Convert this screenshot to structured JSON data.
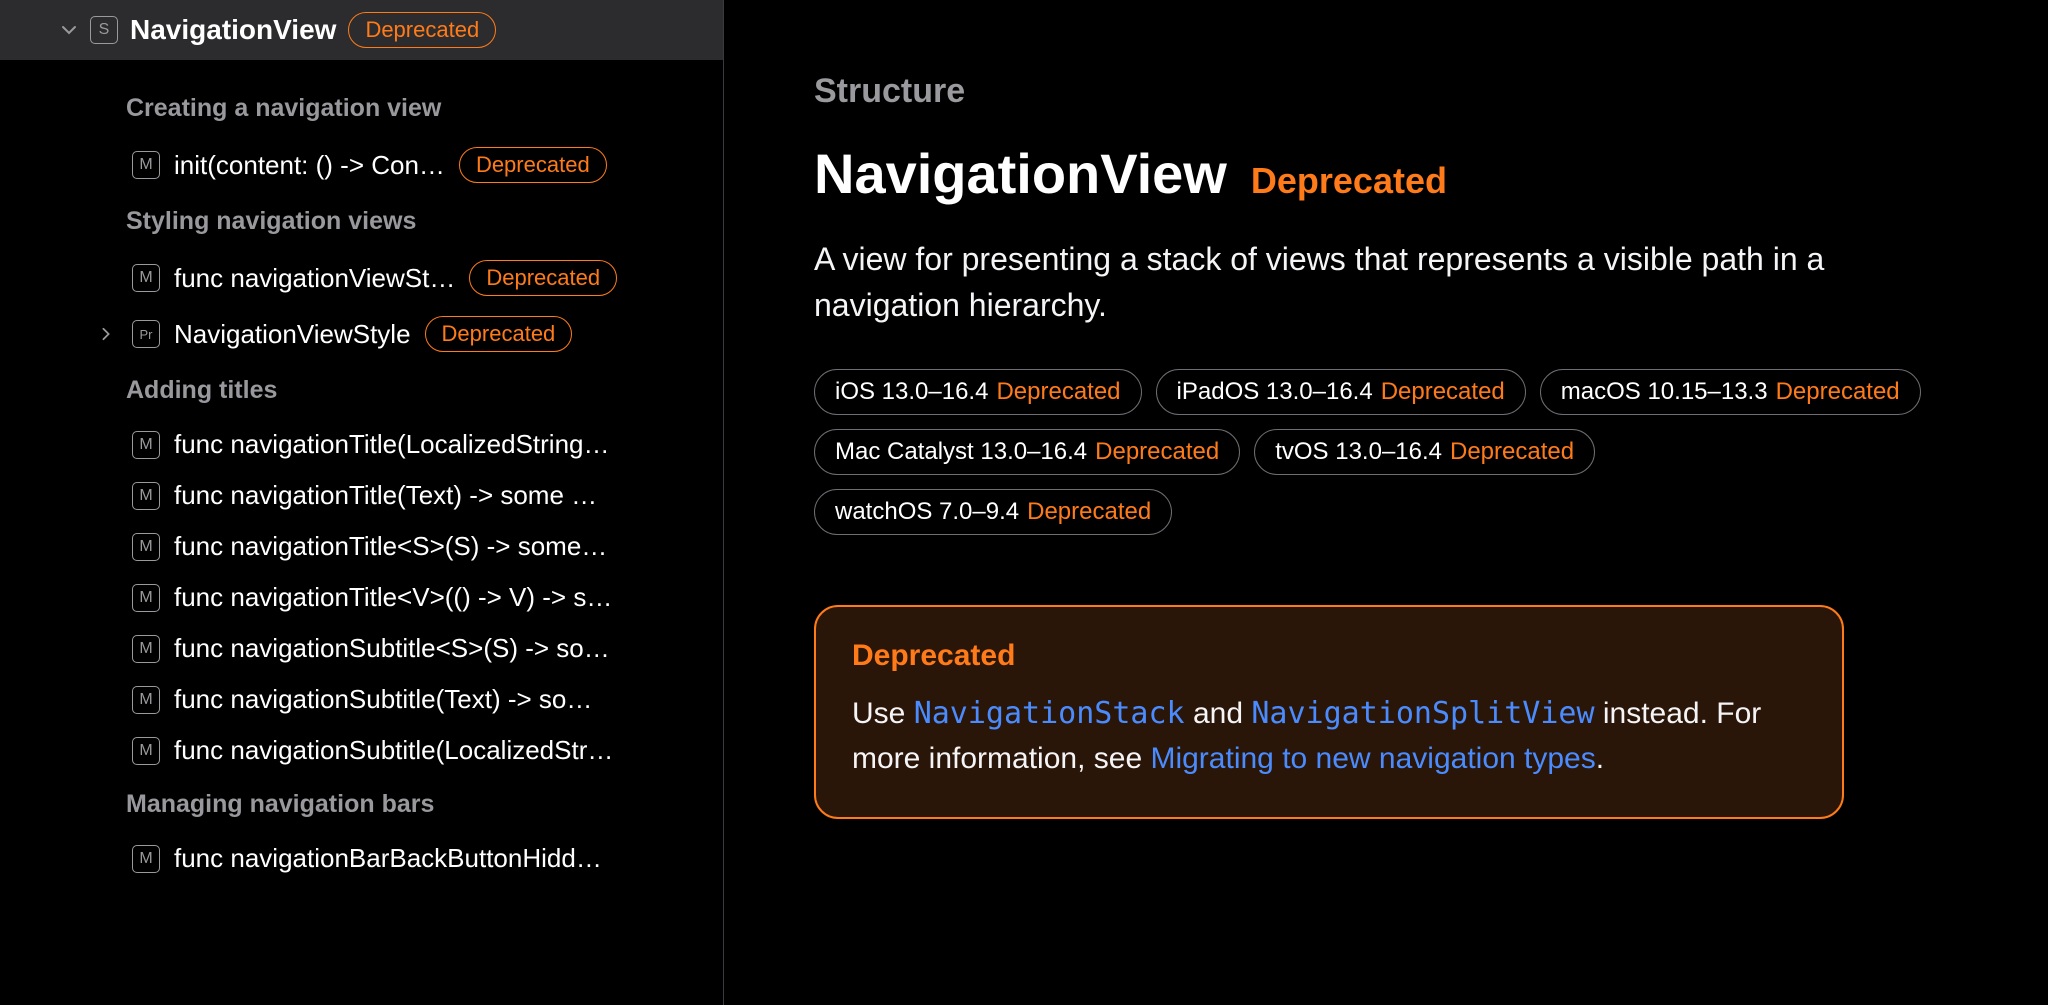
{
  "sidebar": {
    "header": {
      "icon": "S",
      "title": "NavigationView",
      "badge": "Deprecated"
    },
    "sections": [
      {
        "heading": "Creating a navigation view",
        "items": [
          {
            "icon": "M",
            "label": "init(content: () -> Con…",
            "badge": "Deprecated",
            "chevron": false
          }
        ]
      },
      {
        "heading": "Styling navigation views",
        "items": [
          {
            "icon": "M",
            "label": "func navigationViewSt…",
            "badge": "Deprecated",
            "chevron": false
          },
          {
            "icon": "Pr",
            "label": "NavigationViewStyle",
            "badge": "Deprecated",
            "chevron": true
          }
        ]
      },
      {
        "heading": "Adding titles",
        "items": [
          {
            "icon": "M",
            "label": "func navigationTitle(LocalizedStringK…",
            "chevron": false
          },
          {
            "icon": "M",
            "label": "func navigationTitle(Text) -> some Vi…",
            "chevron": false
          },
          {
            "icon": "M",
            "label": "func navigationTitle<S>(S) -> some V…",
            "chevron": false
          },
          {
            "icon": "M",
            "label": "func navigationTitle<V>(() -> V) -> so…",
            "chevron": false
          },
          {
            "icon": "M",
            "label": "func navigationSubtitle<S>(S) -> so…",
            "chevron": false
          },
          {
            "icon": "M",
            "label": "func navigationSubtitle(Text) -> som…",
            "chevron": false
          },
          {
            "icon": "M",
            "label": "func navigationSubtitle(LocalizedStri…",
            "chevron": false
          }
        ]
      },
      {
        "heading": "Managing navigation bars",
        "items": [
          {
            "icon": "M",
            "label": "func navigationBarBackButtonHidden…",
            "chevron": false
          }
        ]
      }
    ]
  },
  "content": {
    "eyebrow": "Structure",
    "title": "NavigationView",
    "title_badge": "Deprecated",
    "summary": "A view for presenting a stack of views that represents a visible path in a navigation hierarchy.",
    "platforms": [
      {
        "name": "iOS 13.0–16.4",
        "status": "Deprecated"
      },
      {
        "name": "iPadOS 13.0–16.4",
        "status": "Deprecated"
      },
      {
        "name": "macOS 10.15–13.3",
        "status": "Deprecated"
      },
      {
        "name": "Mac Catalyst 13.0–16.4",
        "status": "Deprecated"
      },
      {
        "name": "tvOS 13.0–16.4",
        "status": "Deprecated"
      },
      {
        "name": "watchOS 7.0–9.4",
        "status": "Deprecated"
      }
    ],
    "notice": {
      "title": "Deprecated",
      "body_pre": "Use ",
      "link1": "NavigationStack",
      "body_mid1": " and ",
      "link2": "NavigationSplitView",
      "body_mid2": " instead. For more information, see ",
      "link3": "Migrating to new navigation types",
      "body_post": "."
    }
  }
}
